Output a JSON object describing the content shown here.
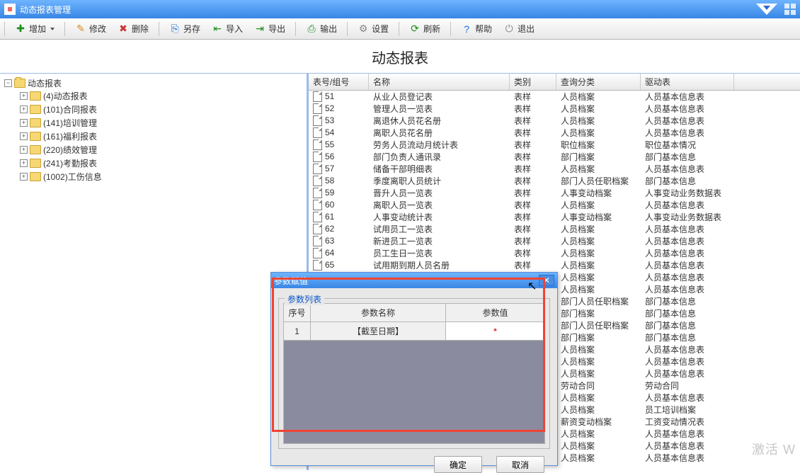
{
  "window": {
    "title": "动态报表管理"
  },
  "toolbar": {
    "add": "增加",
    "edit": "修改",
    "delete": "删除",
    "save_as": "另存",
    "import": "导入",
    "export": "导出",
    "output": "输出",
    "settings": "设置",
    "refresh": "刷新",
    "help": "帮助",
    "exit": "退出"
  },
  "page_heading": "动态报表",
  "tree": {
    "root": "动态报表",
    "nodes": [
      "(4)动态报表",
      "(101)合同报表",
      "(141)培训管理",
      "(161)福利报表",
      "(220)绩效管理",
      "(241)考勤报表",
      "(1002)工伤信息"
    ]
  },
  "grid": {
    "columns": {
      "id": "表号/组号",
      "name": "名称",
      "cat": "类别",
      "query": "查询分类",
      "drive": "驱动表"
    },
    "rows": [
      {
        "id": "51",
        "name": "从业人员登记表",
        "cat": "表样",
        "query": "人员档案",
        "drive": "人员基本信息表"
      },
      {
        "id": "52",
        "name": "管理人员一览表",
        "cat": "表样",
        "query": "人员档案",
        "drive": "人员基本信息表"
      },
      {
        "id": "53",
        "name": "离退休人员花名册",
        "cat": "表样",
        "query": "人员档案",
        "drive": "人员基本信息表"
      },
      {
        "id": "54",
        "name": "离职人员花名册",
        "cat": "表样",
        "query": "人员档案",
        "drive": "人员基本信息表"
      },
      {
        "id": "55",
        "name": "劳务人员流动月统计表",
        "cat": "表样",
        "query": "职位档案",
        "drive": "职位基本情况"
      },
      {
        "id": "56",
        "name": "部门负责人通讯录",
        "cat": "表样",
        "query": "部门档案",
        "drive": "部门基本信息"
      },
      {
        "id": "57",
        "name": "储备干部明细表",
        "cat": "表样",
        "query": "人员档案",
        "drive": "人员基本信息表"
      },
      {
        "id": "58",
        "name": "季度离职人员统计",
        "cat": "表样",
        "query": "部门人员任职档案",
        "drive": "部门基本信息"
      },
      {
        "id": "59",
        "name": "晋升人员一览表",
        "cat": "表样",
        "query": "人事变动档案",
        "drive": "人事变动业务数据表"
      },
      {
        "id": "60",
        "name": "离职人员一览表",
        "cat": "表样",
        "query": "人员档案",
        "drive": "人员基本信息表"
      },
      {
        "id": "61",
        "name": "人事变动统计表",
        "cat": "表样",
        "query": "人事变动档案",
        "drive": "人事变动业务数据表"
      },
      {
        "id": "62",
        "name": "试用员工一览表",
        "cat": "表样",
        "query": "人员档案",
        "drive": "人员基本信息表"
      },
      {
        "id": "63",
        "name": "新进员工一览表",
        "cat": "表样",
        "query": "人员档案",
        "drive": "人员基本信息表"
      },
      {
        "id": "64",
        "name": "员工生日一览表",
        "cat": "表样",
        "query": "人员档案",
        "drive": "人员基本信息表"
      },
      {
        "id": "65",
        "name": "试用期到期人员名册",
        "cat": "表样",
        "query": "人员档案",
        "drive": "人员基本信息表"
      },
      {
        "id": "",
        "name": "",
        "cat": "",
        "query": "人员档案",
        "drive": "人员基本信息表"
      },
      {
        "id": "",
        "name": "",
        "cat": "",
        "query": "人员档案",
        "drive": "人员基本信息表"
      },
      {
        "id": "",
        "name": "",
        "cat": "",
        "query": "部门人员任职档案",
        "drive": "部门基本信息"
      },
      {
        "id": "",
        "name": "",
        "cat": "",
        "query": "部门档案",
        "drive": "部门基本信息"
      },
      {
        "id": "",
        "name": "",
        "cat": "",
        "query": "部门人员任职档案",
        "drive": "部门基本信息"
      },
      {
        "id": "",
        "name": "",
        "cat": "",
        "query": "部门档案",
        "drive": "部门基本信息"
      },
      {
        "id": "",
        "name": "",
        "cat": "",
        "query": "人员档案",
        "drive": "人员基本信息表"
      },
      {
        "id": "",
        "name": "",
        "cat": "",
        "query": "人员档案",
        "drive": "人员基本信息表"
      },
      {
        "id": "",
        "name": "",
        "cat": "",
        "query": "人员档案",
        "drive": "人员基本信息表"
      },
      {
        "id": "",
        "name": "",
        "cat": "",
        "query": "劳动合同",
        "drive": "劳动合同"
      },
      {
        "id": "",
        "name": "",
        "cat": "",
        "query": "人员档案",
        "drive": "人员基本信息表"
      },
      {
        "id": "",
        "name": "",
        "cat": "",
        "query": "人员档案",
        "drive": "员工培训档案"
      },
      {
        "id": "",
        "name": "",
        "cat": "",
        "query": "薪资变动档案",
        "drive": "工资变动情况表"
      },
      {
        "id": "",
        "name": "",
        "cat": "",
        "query": "人员档案",
        "drive": "人员基本信息表"
      },
      {
        "id": "",
        "name": "",
        "cat": "",
        "query": "人员档案",
        "drive": "人员基本信息表"
      },
      {
        "id": "",
        "name": "",
        "cat": "",
        "query": "人员档案",
        "drive": "人员基本信息表"
      }
    ]
  },
  "dialog": {
    "title": "参数赋值",
    "legend": "参数列表",
    "columns": {
      "seq": "序号",
      "pname": "参数名称",
      "pval": "参数值"
    },
    "row": {
      "seq": "1",
      "pname": "【截至日期】",
      "pval_marker": "*"
    },
    "ok": "确定",
    "cancel": "取消"
  },
  "watermark": "激活 W"
}
